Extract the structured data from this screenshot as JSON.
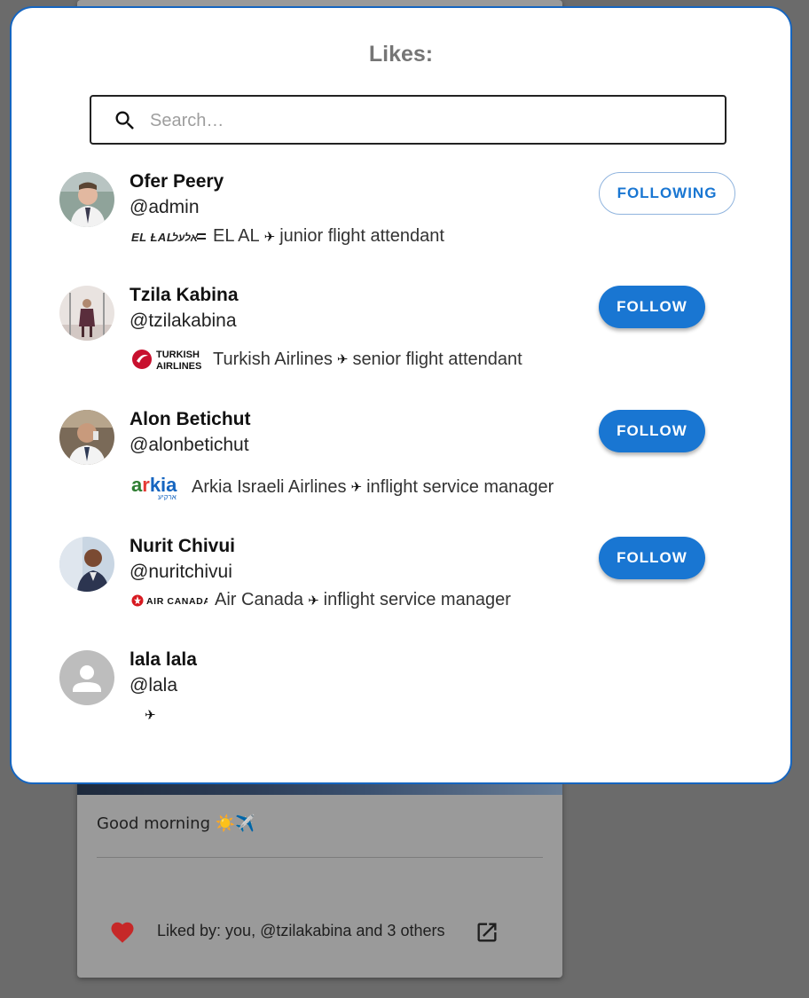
{
  "dialog": {
    "title": "Likes:",
    "search_placeholder": "Search…"
  },
  "users": [
    {
      "name": "Ofer Peery",
      "handle": "@admin",
      "airline_logo": "EL AL",
      "airline": "EL AL",
      "plane": "✈",
      "role": "junior flight attendant",
      "button": "FOLLOWING"
    },
    {
      "name": "Tzila Kabina",
      "handle": "@tzilakabina",
      "airline_logo": "TURKISH AIRLINES",
      "airline": "Turkish Airlines",
      "plane": "✈",
      "role": "senior flight attendant",
      "button": "FOLLOW"
    },
    {
      "name": "Alon Betichut",
      "handle": "@alonbetichut",
      "airline_logo": "arkia",
      "airline": "Arkia Israeli Airlines",
      "plane": "✈",
      "role": "inflight service manager",
      "button": "FOLLOW"
    },
    {
      "name": "Nurit Chivui",
      "handle": "@nuritchivui",
      "airline_logo": "AIR CANADA",
      "airline": "Air Canada",
      "plane": "✈",
      "role": "inflight service manager",
      "button": "FOLLOW"
    },
    {
      "name": "lala lala",
      "handle": "@lala",
      "plane": "✈"
    }
  ],
  "post": {
    "text": "Good morning ☀️✈️",
    "liked_by": "Liked by: you, @tzilakabina and 3 others"
  },
  "colors": {
    "primary": "#1976d2",
    "dialog_border": "#1565c0",
    "heart": "#d32f2f",
    "overlay": "#6b6b6b"
  },
  "icons": [
    "search-icon",
    "heart-icon",
    "open-in-new-icon",
    "default-avatar-icon",
    "airplane-icon"
  ]
}
